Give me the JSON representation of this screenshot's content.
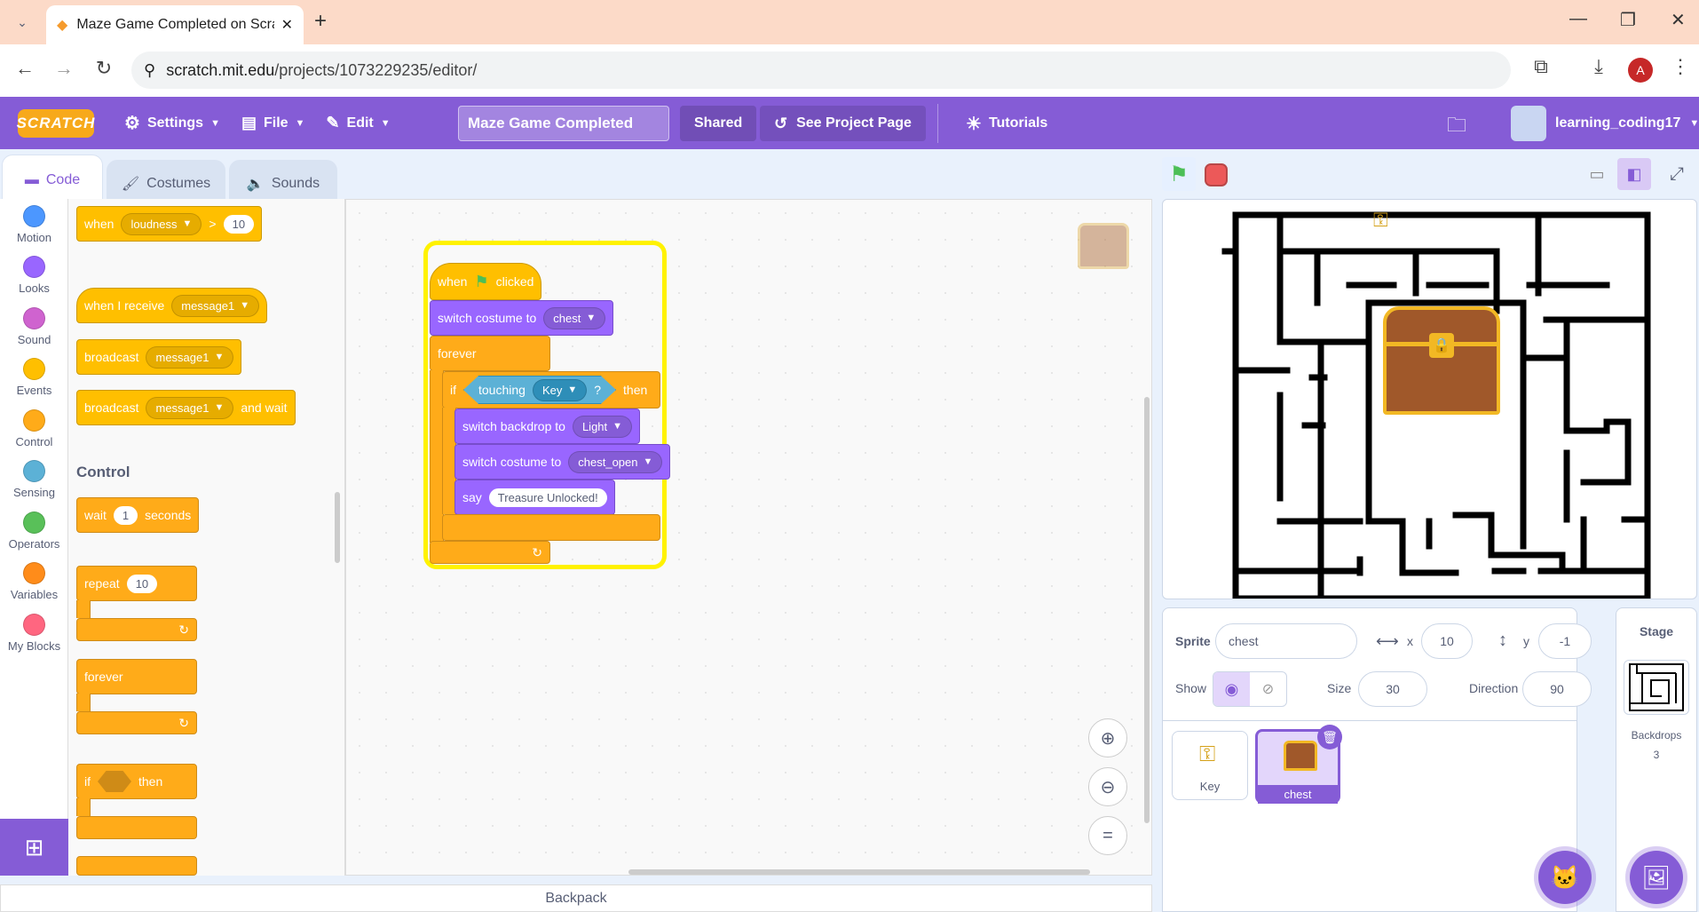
{
  "browser": {
    "tab_title": "Maze Game Completed on Scra",
    "url_host": "scratch.mit.edu",
    "url_path": "/projects/1073229235/editor/",
    "profile_initial": "A"
  },
  "menubar": {
    "logo": "SCRATCH",
    "settings": "Settings",
    "file": "File",
    "edit": "Edit",
    "project_title": "Maze Game Completed",
    "shared": "Shared",
    "see_project": "See Project Page",
    "tutorials": "Tutorials",
    "username": "learning_coding17"
  },
  "editor_tabs": {
    "code": "Code",
    "costumes": "Costumes",
    "sounds": "Sounds"
  },
  "categories": [
    {
      "label": "Motion",
      "color": "#4c97ff"
    },
    {
      "label": "Looks",
      "color": "#9966ff"
    },
    {
      "label": "Sound",
      "color": "#cf63cf"
    },
    {
      "label": "Events",
      "color": "#ffbf00"
    },
    {
      "label": "Control",
      "color": "#ffab19"
    },
    {
      "label": "Sensing",
      "color": "#5cb1d6"
    },
    {
      "label": "Operators",
      "color": "#59c059"
    },
    {
      "label": "Variables",
      "color": "#ff8c1a"
    },
    {
      "label": "My Blocks",
      "color": "#ff6680"
    }
  ],
  "palette": {
    "when": "when",
    "loudness": "loudness",
    "gt": ">",
    "ten": "10",
    "when_receive": "when I receive",
    "message1": "message1",
    "broadcast": "broadcast",
    "and_wait": "and wait",
    "control_heading": "Control",
    "wait": "wait",
    "one": "1",
    "seconds": "seconds",
    "repeat": "repeat",
    "forever": "forever",
    "if": "if",
    "then": "then"
  },
  "script": {
    "when": "when",
    "clicked": "clicked",
    "switch_costume": "switch costume to",
    "costume1": "chest",
    "forever": "forever",
    "if": "if",
    "touching": "touching",
    "key": "Key",
    "q": "?",
    "then": "then",
    "switch_backdrop": "switch backdrop to",
    "backdrop": "Light",
    "costume2": "chest_open",
    "say": "say",
    "say_text": "Treasure Unlocked!"
  },
  "backpack": "Backpack",
  "sprite_info": {
    "sprite_label": "Sprite",
    "sprite_name": "chest",
    "x_label": "x",
    "x": "10",
    "y_label": "y",
    "y": "-1",
    "show_label": "Show",
    "size_label": "Size",
    "size": "30",
    "direction_label": "Direction",
    "direction": "90"
  },
  "sprites": [
    {
      "name": "Key"
    },
    {
      "name": "chest"
    }
  ],
  "stage_panel": {
    "title": "Stage",
    "backdrops_label": "Backdrops",
    "backdrops_count": "3"
  },
  "colors": {
    "scratch_purple": "#855cd6",
    "events": "#ffbf00",
    "control": "#ffab19",
    "looks": "#9966ff",
    "sensing": "#5cb1d6"
  }
}
